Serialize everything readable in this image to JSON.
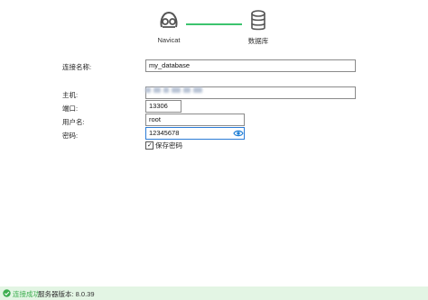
{
  "stepper": {
    "steps": [
      {
        "label": "Navicat",
        "icon": "navicat-logo-icon"
      },
      {
        "label": "数据库",
        "icon": "database-icon"
      }
    ],
    "line_color": "#3cc36e"
  },
  "form": {
    "connection_name": {
      "label": "连接名称:",
      "value": "my_database"
    },
    "host": {
      "label": "主机:",
      "value": ""
    },
    "port": {
      "label": "端口:",
      "value": "13306"
    },
    "username": {
      "label": "用户名:",
      "value": "root"
    },
    "password": {
      "label": "密码:",
      "value": "12345678",
      "icon": "eye-icon"
    },
    "save_password": {
      "label": "保存密码",
      "checked": true
    }
  },
  "status": {
    "message": "连接成功",
    "version": "服务器版本: 8.0.39",
    "color": "#3cae4f",
    "background": "#e3f5e4"
  }
}
